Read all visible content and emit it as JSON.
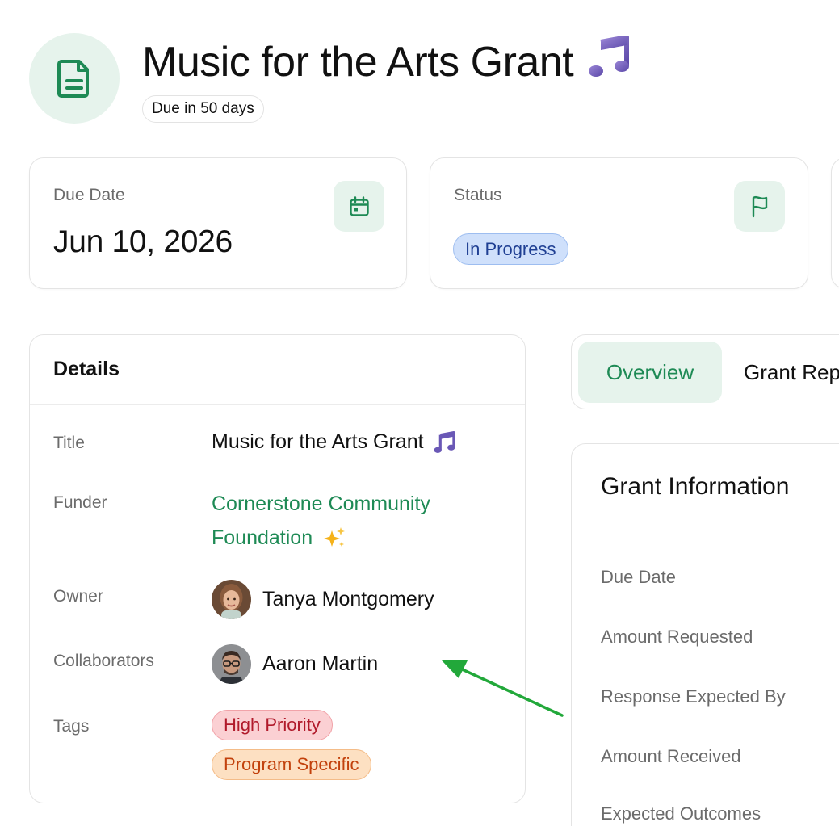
{
  "header": {
    "title": "Music for the Arts Grant",
    "title_emoji": "🎵",
    "due_pill": "Due in 50 days",
    "icon": "document-icon"
  },
  "stats": {
    "due_date": {
      "label": "Due Date",
      "value": "Jun 10, 2026",
      "icon": "calendar-icon"
    },
    "status": {
      "label": "Status",
      "value": "In Progress",
      "icon": "flag-icon"
    }
  },
  "details": {
    "heading": "Details",
    "title_label": "Title",
    "title_value": "Music for the Arts Grant",
    "title_emoji": "🎵",
    "funder_label": "Funder",
    "funder_line1": "Cornerstone Community",
    "funder_line2": "Foundation",
    "funder_emoji": "✨",
    "owner_label": "Owner",
    "owner_name": "Tanya Montgomery",
    "collaborators_label": "Collaborators",
    "collaborator_name": "Aaron Martin",
    "tags_label": "Tags",
    "tags": [
      "High Priority",
      "Program Specific"
    ]
  },
  "tabs": {
    "overview": "Overview",
    "grant_rep": "Grant Rep"
  },
  "grant_info": {
    "heading": "Grant Information",
    "rows": [
      "Due Date",
      "Amount Requested",
      "Response Expected By",
      "Amount Received",
      "Expected Outcomes"
    ]
  },
  "colors": {
    "accent_green": "#1e8a55",
    "status_blue": "#1f3f93",
    "annotation_arrow": "#22a83a"
  }
}
